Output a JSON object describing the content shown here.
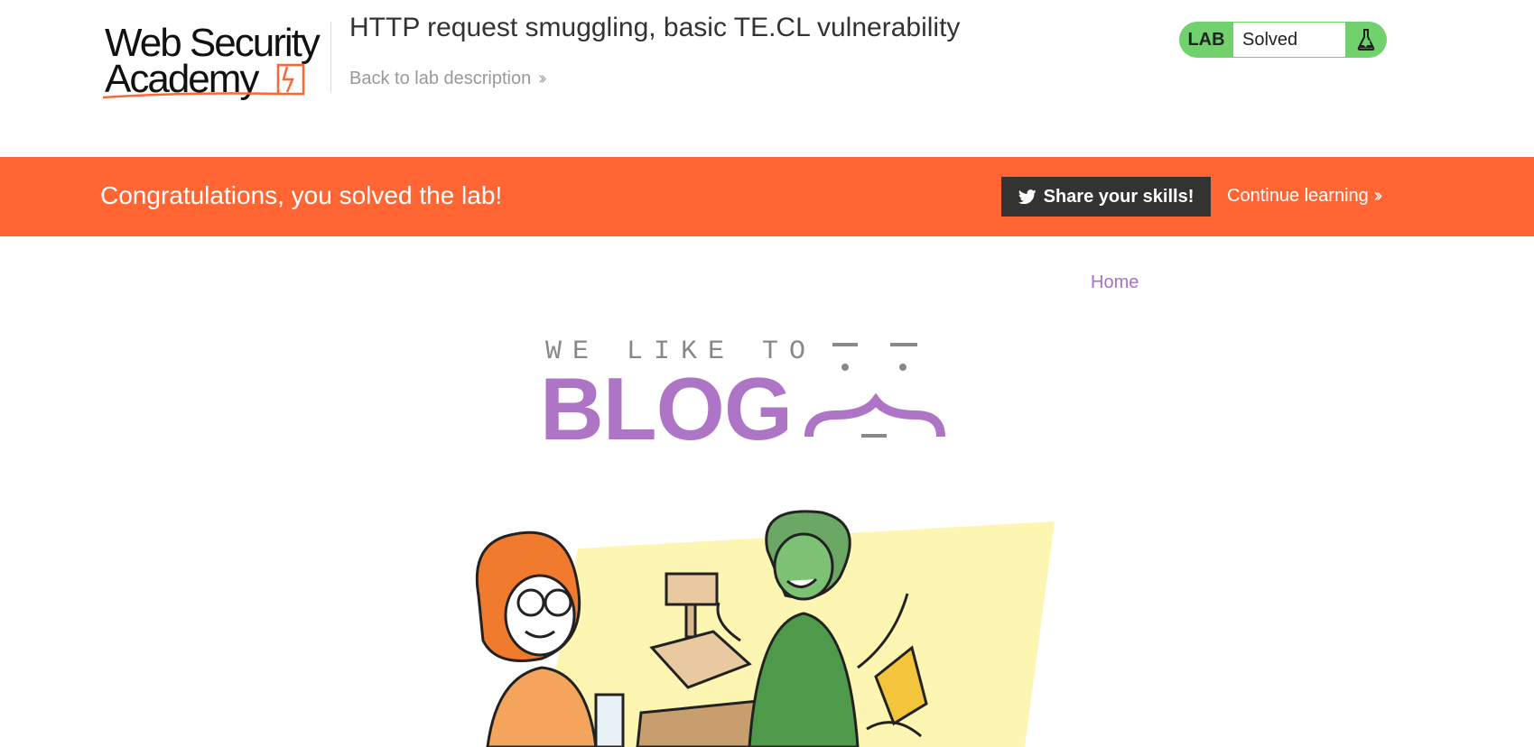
{
  "header": {
    "logo": {
      "line1": "Web Security",
      "line2": "Academy"
    },
    "lab_title": "HTTP request smuggling, basic TE.CL vulnerability",
    "back_link": "Back to lab description",
    "status": {
      "badge": "LAB",
      "value": "Solved",
      "icon": "flask-icon"
    }
  },
  "banner": {
    "message": "Congratulations, you solved the lab!",
    "share_label": "Share your skills!",
    "share_icon": "twitter-icon",
    "continue_label": "Continue learning"
  },
  "blog": {
    "nav_home": "Home",
    "tagline": "WE LIKE TO",
    "wordmark": "BLOG"
  },
  "colors": {
    "banner": "#ff6633",
    "status_green": "#70d16d",
    "blog_purple": "#ae75c6",
    "share_button": "#333332"
  }
}
